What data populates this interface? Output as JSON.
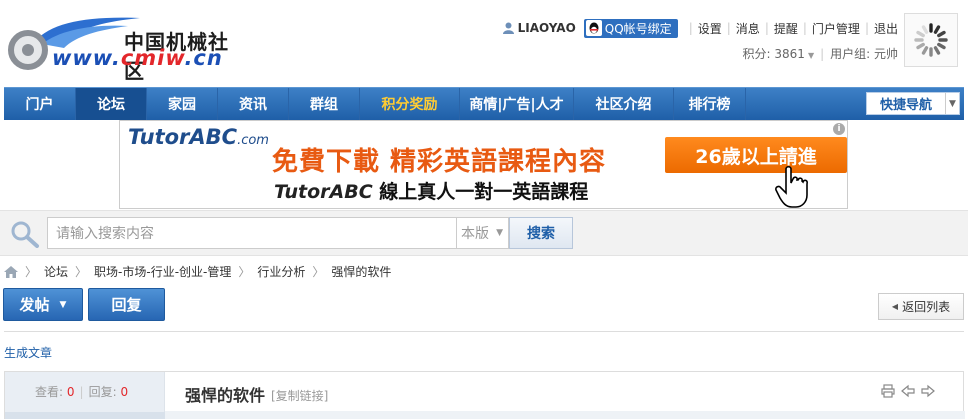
{
  "logo": {
    "cn_name": "中国机械社区",
    "url_prefix": "www.",
    "url_accent": "cmiw",
    "url_suffix": ".cn"
  },
  "user": {
    "name": "LIAOYAO",
    "qq_label": "QQ帐号绑定",
    "links": [
      "设置",
      "消息",
      "提醒",
      "门户管理",
      "退出"
    ],
    "points_label": "积分: 3861",
    "group_label": "用户组: 元帅"
  },
  "nav": {
    "items": [
      {
        "label": "门户",
        "active": false,
        "highlight": false
      },
      {
        "label": "论坛",
        "active": true,
        "highlight": false
      },
      {
        "label": "家园",
        "active": false,
        "highlight": false
      },
      {
        "label": "资讯",
        "active": false,
        "highlight": false
      },
      {
        "label": "群组",
        "active": false,
        "highlight": false
      },
      {
        "label": "积分奖励",
        "active": false,
        "highlight": true
      },
      {
        "label": "商情|广告|人才",
        "active": false,
        "highlight": false
      },
      {
        "label": "社区介绍",
        "active": false,
        "highlight": false
      },
      {
        "label": "排行榜",
        "active": false,
        "highlight": false
      }
    ],
    "quick_nav": "快捷导航"
  },
  "banner": {
    "brand": "TutorABC",
    "brand_domain": ".com",
    "headline": "免費下載 精彩英語課程內容",
    "sub_brand": "TutorABC",
    "sub_text": " 線上真人一對一英語課程",
    "cta": "26歲以上請進",
    "info": "i"
  },
  "search": {
    "placeholder": "请输入搜索内容",
    "scope": "本版",
    "button": "搜索"
  },
  "breadcrumb": [
    "论坛",
    "职场-市场-行业-创业-管理",
    "行业分析",
    "强悍的软件"
  ],
  "actions": {
    "post": "发帖",
    "reply": "回复",
    "back": "返回列表"
  },
  "generate_article": "生成文章",
  "thread": {
    "views_label": "查看:",
    "views": "0",
    "replies_label": "回复:",
    "replies": "0",
    "title": "强悍的软件",
    "copy_link": "[复制链接]"
  },
  "colors": {
    "nav_blue": "#2766b3",
    "accent_red": "#e3272b",
    "highlight_orange": "#ffcc33"
  }
}
